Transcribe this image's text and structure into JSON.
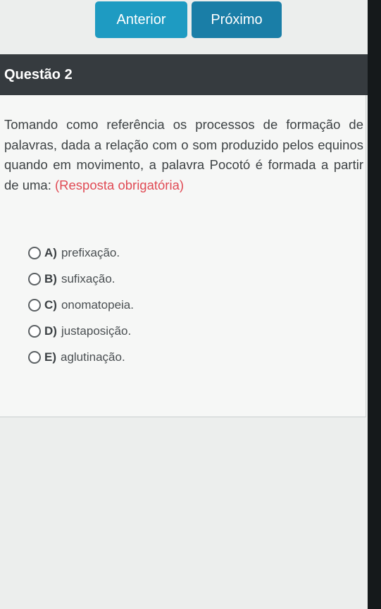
{
  "nav": {
    "prev_label": "Anterior",
    "next_label": "Próximo"
  },
  "question": {
    "heading": "Questão 2",
    "text": "Tomando como referência os processos de formação de palavras, dada a relação com o som produzido pelos equinos quando em movimento, a palavra Pocotó é formada a partir de uma: ",
    "required_note": "(Resposta obrigatória)"
  },
  "options": [
    {
      "letter": "A)",
      "text": "prefixação."
    },
    {
      "letter": "B)",
      "text": "sufixação."
    },
    {
      "letter": "C)",
      "text": "onomatopeia."
    },
    {
      "letter": "D)",
      "text": "justaposição."
    },
    {
      "letter": "E)",
      "text": "aglutinação."
    }
  ],
  "colors": {
    "prev_button": "#1e9bc2",
    "next_button": "#1a7ea7",
    "header_bar": "#363b3f",
    "required_note": "#e04a54"
  }
}
